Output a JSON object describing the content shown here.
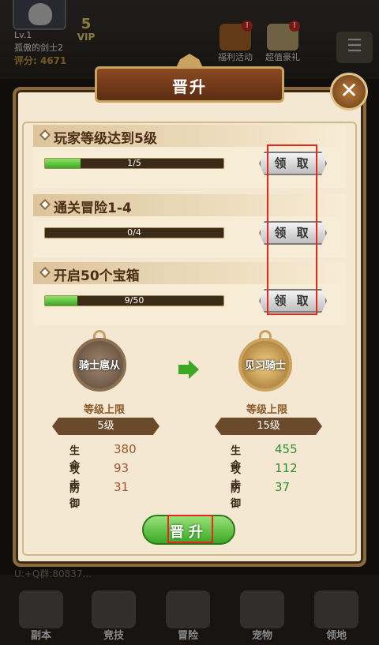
{
  "hud": {
    "level": "Lv.1",
    "player_name": "孤傲的剑士2",
    "score": "评分: 4671",
    "vip_number": "5",
    "vip_label": "VIP",
    "welfare_label": "福利活动",
    "gift_label": "超值豪礼",
    "badge": "!"
  },
  "dialog": {
    "title": "晋升",
    "close_glyph": "✕"
  },
  "tasks": [
    {
      "title": "玩家等级达到5级",
      "progress_text": "1/5",
      "progress_fraction": 0.2,
      "claim_label": "领 取"
    },
    {
      "title": "通关冒险1-4",
      "progress_text": "0/4",
      "progress_fraction": 0.0,
      "claim_label": "领 取"
    },
    {
      "title": "开启50个宝箱",
      "progress_text": "9/50",
      "progress_fraction": 0.18,
      "claim_label": "领 取"
    }
  ],
  "current_rank": {
    "name": "骑士扈从",
    "cap_label": "等级上限",
    "cap_value": "5级",
    "stats": [
      {
        "key": "生命",
        "value": "380"
      },
      {
        "key": "攻击",
        "value": "93"
      },
      {
        "key": "防御",
        "value": "31"
      }
    ]
  },
  "next_rank": {
    "name": "见习骑士",
    "cap_label": "等级上限",
    "cap_value": "15级",
    "stats": [
      {
        "key": "生命",
        "value": "455"
      },
      {
        "key": "攻击",
        "value": "112"
      },
      {
        "key": "防御",
        "value": "37"
      }
    ]
  },
  "promote_button": "晋升",
  "chat_preview": "U:+Q群:80837...",
  "bottom_nav": [
    "副本",
    "竞技",
    "冒险",
    "宠物",
    "领地"
  ],
  "colors": {
    "current_stat": "#a0522d",
    "next_stat": "#2e8b2e",
    "highlight": "#e8261e"
  }
}
